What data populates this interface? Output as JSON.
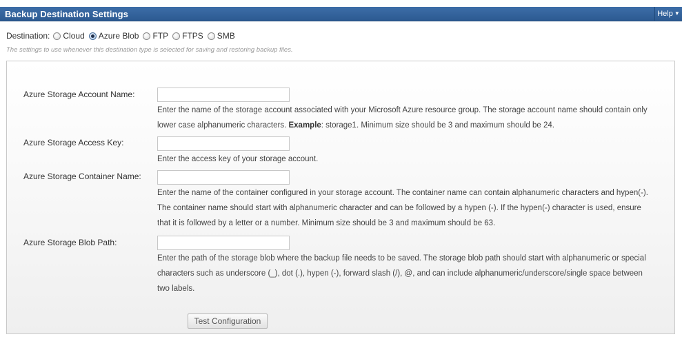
{
  "header": {
    "title": "Backup Destination Settings",
    "help_label": "Help"
  },
  "destination": {
    "label": "Destination:",
    "options": [
      {
        "label": "Cloud",
        "checked": false
      },
      {
        "label": "Azure Blob",
        "checked": true
      },
      {
        "label": "FTP",
        "checked": false
      },
      {
        "label": "FTPS",
        "checked": false
      },
      {
        "label": "SMB",
        "checked": false
      }
    ],
    "hint": "The settings to use whenever this destination type is selected for saving and restoring backup files."
  },
  "fields": {
    "account_name": {
      "label": "Azure Storage Account Name:",
      "value": "",
      "help_pre": "Enter the name of the storage account associated with your Microsoft Azure resource group. The storage account name should contain only lower case alphanumeric characters. ",
      "help_bold": "Example",
      "help_post": ": storage1. Minimum size should be 3 and maximum should be 24."
    },
    "access_key": {
      "label": "Azure Storage Access Key:",
      "value": "",
      "help": "Enter the access key of your storage account."
    },
    "container_name": {
      "label": "Azure Storage Container Name:",
      "value": "",
      "help": "Enter the name of the container configured in your storage account. The container name can contain alphanumeric characters and hypen(-). The container name should start with alphanumeric character and can be followed by a hypen (-). If the hypen(-) character is used, ensure that it is followed by a letter or a number. Minimum size should be 3 and maximum should be 63."
    },
    "blob_path": {
      "label": "Azure Storage Blob Path:",
      "value": "",
      "help": "Enter the path of the storage blob where the backup file needs to be saved. The storage blob path should start with alphanumeric or special characters such as underscore (_), dot (.), hypen (-), forward slash (/), @, and can include alphanumeric/underscore/single space between two labels."
    }
  },
  "actions": {
    "test_label": "Test Configuration"
  }
}
